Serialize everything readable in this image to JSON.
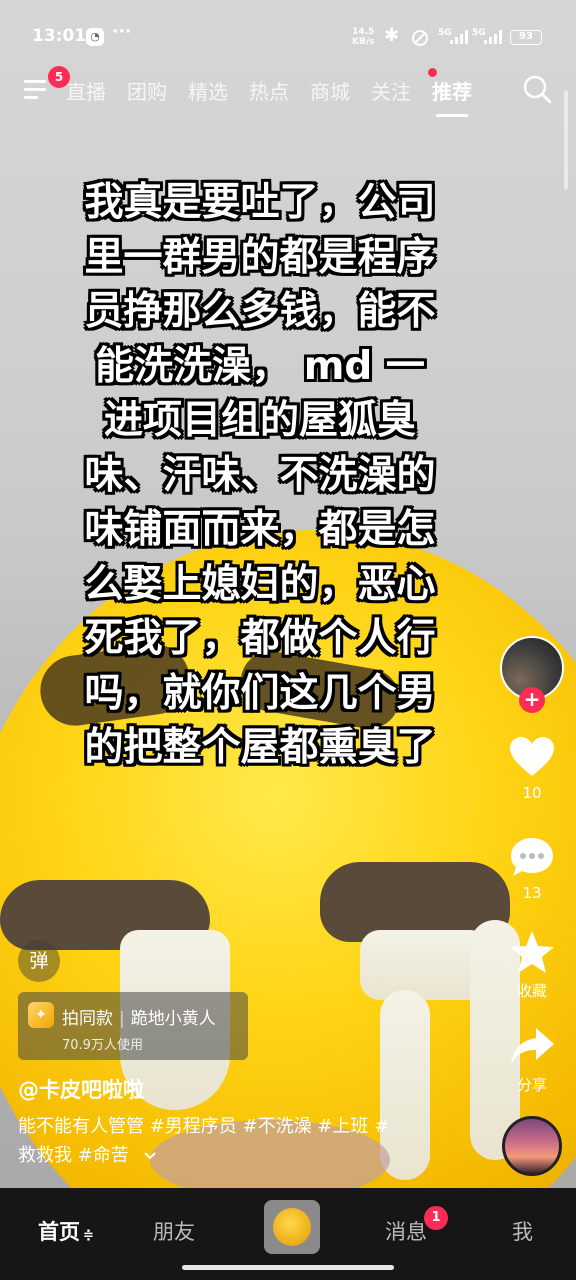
{
  "status_bar": {
    "time": "13:01",
    "more": "···",
    "net_speed_value": "14.5",
    "net_speed_unit": "KB/s",
    "sim1": "5G",
    "sim2": "5G",
    "battery": "93"
  },
  "top_nav": {
    "menu_badge": "5",
    "tabs": [
      {
        "label": "直播"
      },
      {
        "label": "团购"
      },
      {
        "label": "精选"
      },
      {
        "label": "热点"
      },
      {
        "label": "商城"
      },
      {
        "label": "关注"
      },
      {
        "label": "推荐"
      }
    ],
    "active_tab": "推荐"
  },
  "video": {
    "headline_lines": [
      "我真是要吐了，公司",
      "里一群男的都是程序",
      "员挣那么多钱，能不",
      "能洗洗澡， md 一",
      "进项目组的屋狐臭",
      "味、汗味、不洗澡的",
      "味铺面而来，都是怎",
      "么娶上媳妇的，恶心",
      "死我了，都做个人行",
      "吗，就你们这几个男",
      "的把整个屋都熏臭了"
    ]
  },
  "right_rail": {
    "like_count": "10",
    "comment_count": "13",
    "favorite_label": "收藏",
    "share_label": "分享"
  },
  "info": {
    "danmu_label": "弹",
    "template_action": "拍同款",
    "template_name": "跪地小黄人",
    "template_users": "70.9万人使用",
    "author": "@卡皮吧啦啦",
    "caption_line1": "能不能有人管管 #男程序员 #不洗澡 #上班 #",
    "caption_line2": "救救我 #命苦",
    "expand_icon": "chevron-down-icon"
  },
  "bottom_nav": {
    "home": "首页",
    "home_suffix": "≑",
    "friends": "朋友",
    "messages": "消息",
    "messages_badge": "1",
    "me": "我"
  },
  "colors": {
    "accent": "#fe2c55",
    "nav_background": "#161616"
  }
}
